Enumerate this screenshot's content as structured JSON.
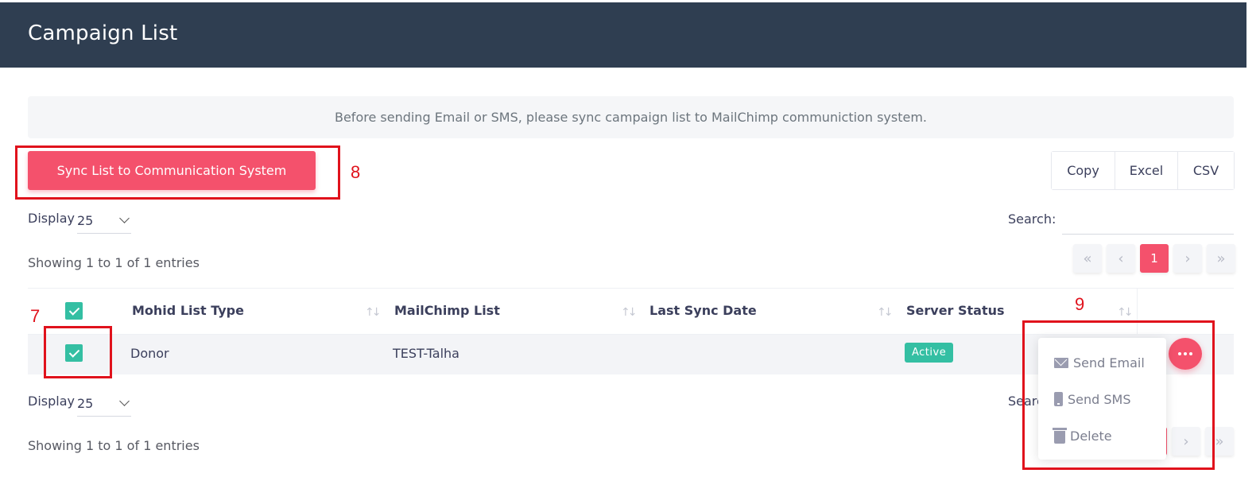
{
  "header": {
    "title": "Campaign List"
  },
  "notice": {
    "text": "Before sending Email or SMS, please sync campaign list to MailChimp communiction system."
  },
  "toolbar": {
    "sync_label": "Sync List to Communication System",
    "export_buttons": [
      "Copy",
      "Excel",
      "CSV"
    ]
  },
  "top_controls": {
    "display_label": "Display",
    "display_value": "25",
    "search_label": "Search:",
    "showing_text": "Showing 1 to 1 of 1 entries"
  },
  "pagination": {
    "first": "«",
    "prev": "‹",
    "current": "1",
    "next": "›",
    "last": "»"
  },
  "table": {
    "columns": [
      "Mohid List Type",
      "MailChimp List",
      "Last Sync Date",
      "Server Status"
    ],
    "rows": [
      {
        "list_type": "Donor",
        "mailchimp_list": "TEST-Talha",
        "last_sync_date": "",
        "server_status": "Active"
      }
    ]
  },
  "bottom_controls": {
    "display_label": "Display",
    "display_value": "25",
    "search_label": "Searc",
    "showing_text": "Showing 1 to 1 of 1 entries"
  },
  "actions_menu": {
    "items": [
      {
        "label": "Send Email",
        "icon": "envelope-icon"
      },
      {
        "label": "Send SMS",
        "icon": "phone-icon"
      },
      {
        "label": "Delete",
        "icon": "trash-icon"
      }
    ]
  },
  "annotations": {
    "seven": "7",
    "eight": "8",
    "nine": "9"
  },
  "colors": {
    "header_bg": "#2f3e51",
    "accent": "#f4516c",
    "success": "#34bfa3",
    "annotation": "#e0121c"
  }
}
